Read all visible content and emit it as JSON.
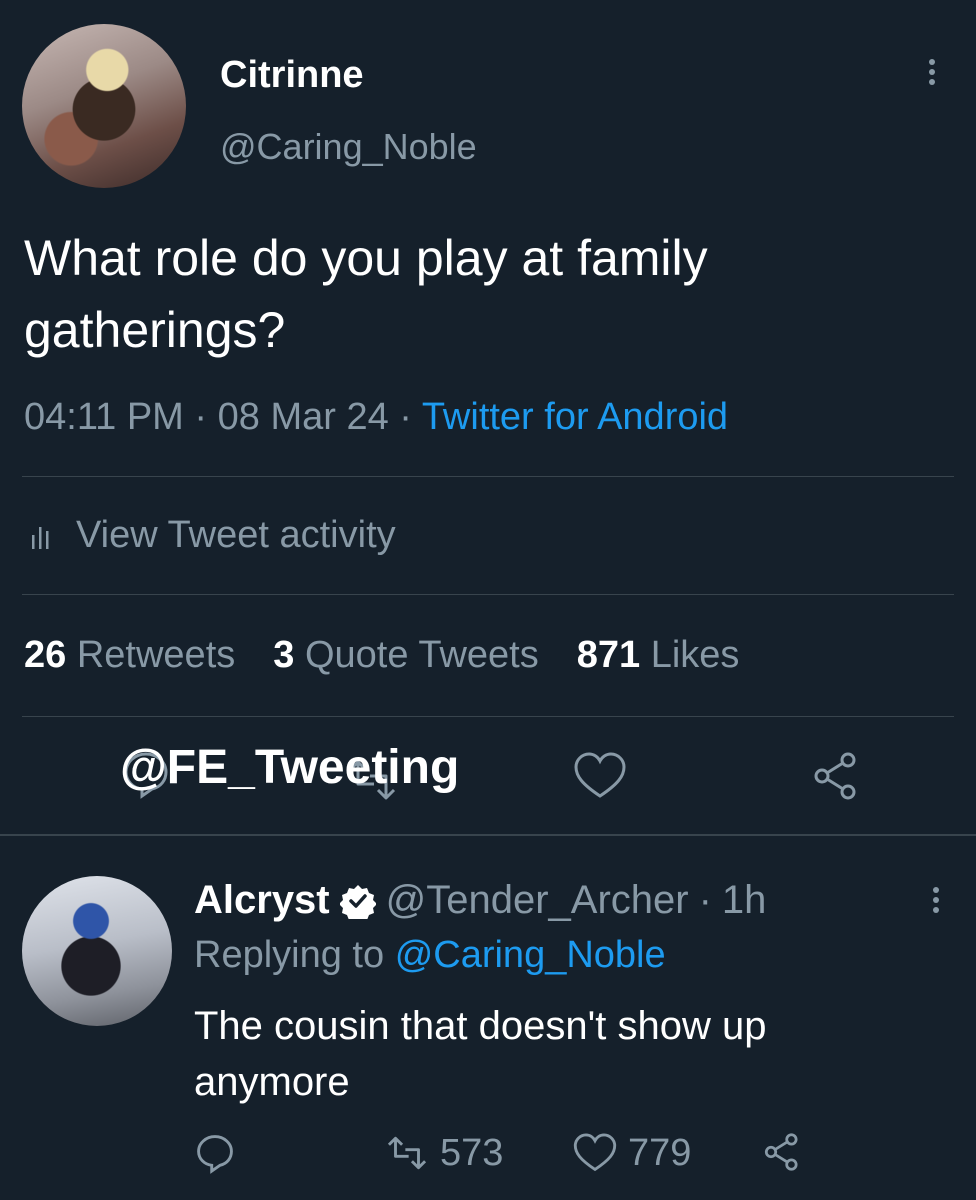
{
  "tweet": {
    "display_name": "Citrinne",
    "handle": "@Caring_Noble",
    "text": "What role do you play at family gatherings?",
    "time": "04:11 PM",
    "date": "08 Mar 24",
    "separator": "·",
    "source": "Twitter for Android",
    "activity_label": "View Tweet activity",
    "retweets_count": "26",
    "retweets_label": "Retweets",
    "quotes_count": "3",
    "quotes_label": "Quote Tweets",
    "likes_count": "871",
    "likes_label": "Likes"
  },
  "watermark": "@FE_Tweeting",
  "reply": {
    "display_name": "Alcryst",
    "handle": "@Tender_Archer",
    "time_sep": "·",
    "time": "1h",
    "replying_to_label": "Replying to",
    "replying_to_handle": "@Caring_Noble",
    "text": "The cousin that doesn't show up anymore",
    "retweets": "573",
    "likes": "779"
  },
  "colors": {
    "background": "#15202b",
    "secondary_text": "#8899a6",
    "link": "#1d9bf0",
    "divider": "#38444d"
  },
  "icons": [
    "more-icon",
    "stats-icon",
    "reply-icon",
    "retweet-icon",
    "heart-icon",
    "share-icon",
    "verified-icon"
  ]
}
